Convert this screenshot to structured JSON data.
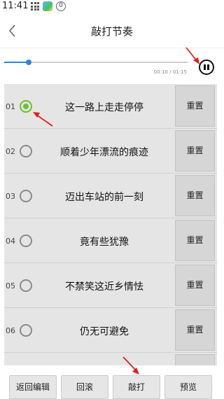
{
  "status_bar": {
    "time": "11:41",
    "notification_count": "0",
    "icons": [
      "grid-icon",
      "app-icon",
      "notification-icon"
    ]
  },
  "header": {
    "title": "敲打节奏",
    "back_icon": "chevron-left-icon"
  },
  "player": {
    "current_time": "00:10",
    "total_time": "01:15",
    "progress": 0.133,
    "progress_color": "#2f84d9",
    "pause_icon": "pause-icon"
  },
  "lyrics": [
    {
      "number": "01",
      "text": "这一路上走走停停",
      "selected": true,
      "reset_label": "重置"
    },
    {
      "number": "02",
      "text": "顺着少年漂流的痕迹",
      "selected": false,
      "reset_label": "重置"
    },
    {
      "number": "03",
      "text": "迈出车站的前一刻",
      "selected": false,
      "reset_label": "重置"
    },
    {
      "number": "04",
      "text": "竟有些犹豫",
      "selected": false,
      "reset_label": "重置"
    },
    {
      "number": "05",
      "text": "不禁笑这近乡情怯",
      "selected": false,
      "reset_label": "重置"
    },
    {
      "number": "06",
      "text": "仍无可避免",
      "selected": false,
      "reset_label": "重置"
    },
    {
      "number": "",
      "text": "",
      "selected": false,
      "reset_label": ""
    }
  ],
  "colors": {
    "accent_selected": "#6ac32a",
    "annotation_red": "#e02020"
  },
  "bottom_bar": {
    "back_edit_label": "返回编辑",
    "rewind_label": "回滚",
    "tap_label": "敲打",
    "preview_label": "预览"
  }
}
